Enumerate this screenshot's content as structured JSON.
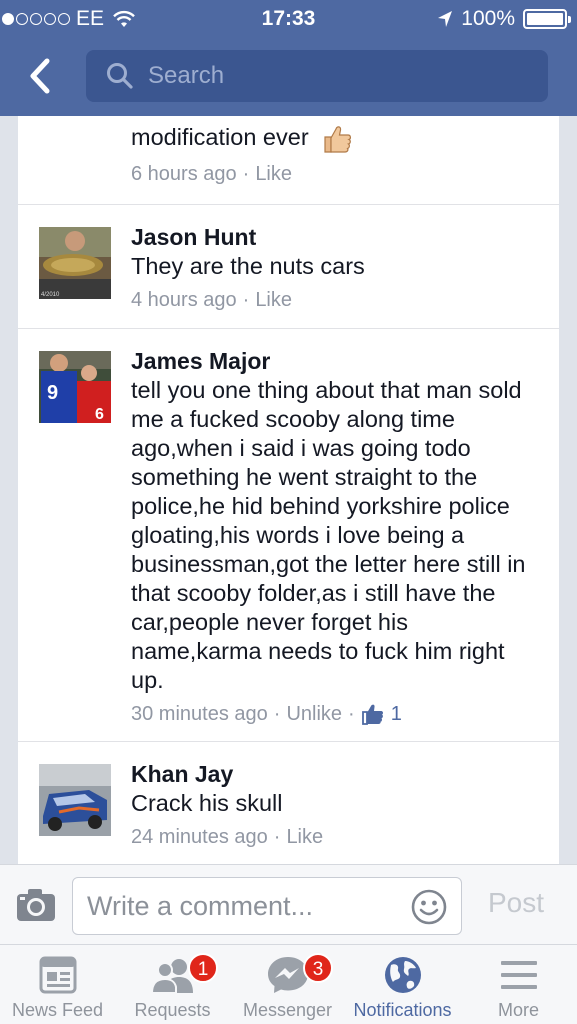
{
  "status_bar": {
    "signal_dots": 5,
    "signal_filled": 1,
    "carrier": "EE",
    "time": "17:33",
    "battery": "100%"
  },
  "nav": {
    "back_icon": "chevron-left-icon",
    "search_placeholder": "Search"
  },
  "comments": [
    {
      "name": "",
      "text": "modification ever",
      "has_thumb_emoji": true,
      "time": "6 hours ago",
      "action": "Like"
    },
    {
      "name": "Jason Hunt",
      "text": "They are the nuts cars",
      "time": "4 hours ago",
      "action": "Like",
      "avatar_caption": "4/2010"
    },
    {
      "name": "James Major",
      "text": "tell you one thing about that man sold me a fucked scooby along time ago,when i said i was going todo something he went straight to the police,he hid behind yorkshire police gloating,his words i love being a businessman,got the letter here still in that scooby folder,as i still have the car,people never forget his name,karma needs to fuck him right up.",
      "time": "30 minutes ago",
      "action": "Unlike",
      "like_count": "1",
      "avatar_numbers": [
        "9",
        "6"
      ]
    },
    {
      "name": "Khan Jay",
      "text": "Crack his skull",
      "time": "24 minutes ago",
      "action": "Like"
    }
  ],
  "composer": {
    "placeholder": "Write a comment...",
    "post_label": "Post"
  },
  "tabs": [
    {
      "label": "News Feed",
      "icon": "news-feed-icon",
      "badge": ""
    },
    {
      "label": "Requests",
      "icon": "friend-requests-icon",
      "badge": "1"
    },
    {
      "label": "Messenger",
      "icon": "messenger-icon",
      "badge": "3"
    },
    {
      "label": "Notifications",
      "icon": "globe-icon",
      "badge": "",
      "active": true
    },
    {
      "label": "More",
      "icon": "menu-icon",
      "badge": ""
    }
  ],
  "colors": {
    "brand_blue": "#4e69a2",
    "search_bg": "#3b5690",
    "badge_red": "#e0261a",
    "meta_gray": "#9197a3"
  }
}
